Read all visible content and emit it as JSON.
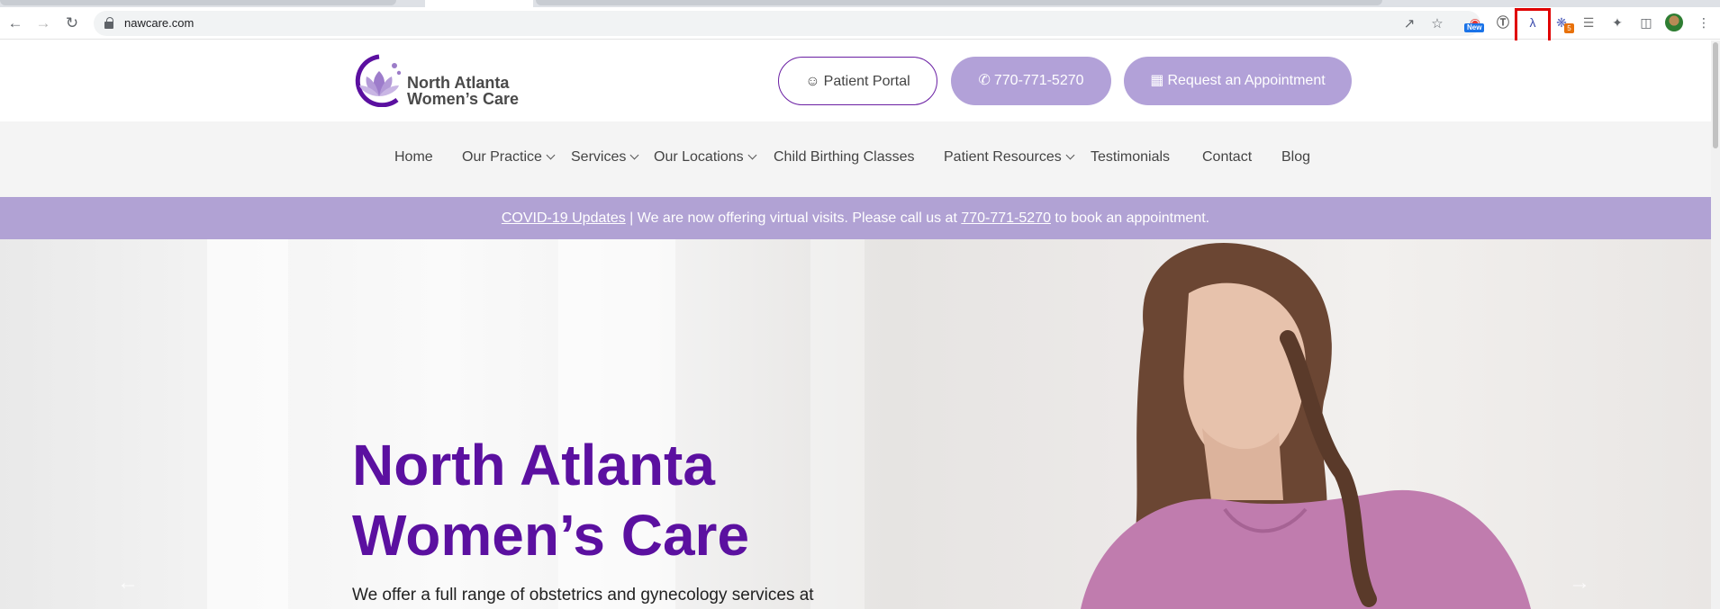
{
  "browser": {
    "url": "nawcare.com",
    "extension_new_badge": "New",
    "extension_count_badge": "5",
    "icons": [
      "back-icon",
      "forward-icon",
      "reload-icon",
      "lock-icon",
      "share-icon",
      "star-icon",
      "puzzle-icon",
      "sidepanel-icon",
      "menu-icon"
    ]
  },
  "header": {
    "logo_line1": "North Atlanta",
    "logo_line2": "Women’s Care",
    "portal_label": "Patient Portal",
    "phone_label": "770-771-5270",
    "appointment_label": "Request an Appointment"
  },
  "nav": {
    "items": [
      {
        "label": "Home"
      },
      {
        "label": "Our Practice"
      },
      {
        "label": "Services"
      },
      {
        "label": "Our Locations"
      },
      {
        "label": "Child Birthing Classes"
      },
      {
        "label": "Patient Resources"
      },
      {
        "label": "Testimonials"
      },
      {
        "label": "Contact"
      },
      {
        "label": "Blog"
      }
    ]
  },
  "banner": {
    "link1": "COVID-19 Updates",
    "text1": " | We are now offering virtual visits. Please call us at ",
    "link2": "770-771-5270",
    "text2": " to book an appointment."
  },
  "hero": {
    "title_line1": "North Atlanta",
    "title_line2": "Women’s Care",
    "subtitle": "We offer a full range of obstetrics and gynecology services at"
  },
  "colors": {
    "brand_purple": "#5b10a0",
    "lavender": "#b2a1d8",
    "highlight_red": "#e00000"
  }
}
